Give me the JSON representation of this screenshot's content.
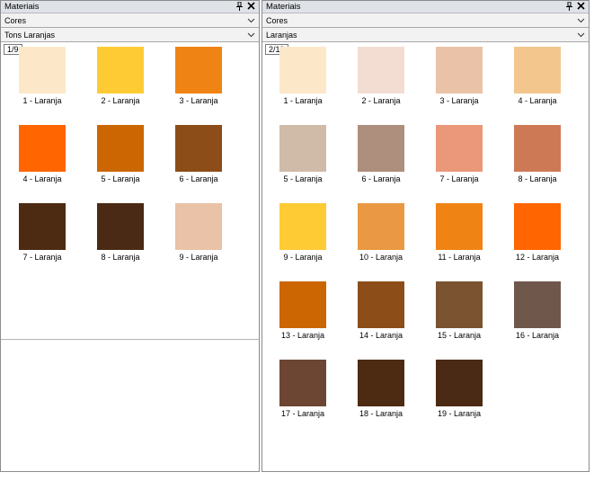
{
  "left_panel": {
    "title": "Materiais",
    "category": "Cores",
    "subcategory": "Tons Laranjas",
    "counter": "1/9",
    "swatches": [
      {
        "label": "1 - Laranja",
        "color": "#fce8c9"
      },
      {
        "label": "2 - Laranja",
        "color": "#fecb35"
      },
      {
        "label": "3 - Laranja",
        "color": "#ef8415"
      },
      {
        "label": "4 - Laranja",
        "color": "#ff6501"
      },
      {
        "label": "5 - Laranja",
        "color": "#cc6603"
      },
      {
        "label": "6 - Laranja",
        "color": "#8c4d18"
      },
      {
        "label": "7 - Laranja",
        "color": "#4d2a12"
      },
      {
        "label": "8 - Laranja",
        "color": "#4a2a14"
      },
      {
        "label": "9 - Laranja",
        "color": "#eac2a7"
      }
    ]
  },
  "right_panel": {
    "title": "Materiais",
    "category": "Cores",
    "subcategory": "Laranjas",
    "counter": "2/19",
    "swatches": [
      {
        "label": "1 - Laranja",
        "color": "#fce8c9"
      },
      {
        "label": "2 - Laranja",
        "color": "#f3ddd2"
      },
      {
        "label": "3 - Laranja",
        "color": "#eac2a7"
      },
      {
        "label": "4 - Laranja",
        "color": "#f3c68e"
      },
      {
        "label": "5 - Laranja",
        "color": "#d0bba9"
      },
      {
        "label": "6 - Laranja",
        "color": "#ae8e7d"
      },
      {
        "label": "7 - Laranja",
        "color": "#ea9879"
      },
      {
        "label": "8 - Laranja",
        "color": "#ce7955"
      },
      {
        "label": "9 - Laranja",
        "color": "#fecb35"
      },
      {
        "label": "10 - Laranja",
        "color": "#ea9843"
      },
      {
        "label": "11 - Laranja",
        "color": "#ef8415"
      },
      {
        "label": "12 - Laranja",
        "color": "#ff6501"
      },
      {
        "label": "13 - Laranja",
        "color": "#cc6603"
      },
      {
        "label": "14 - Laranja",
        "color": "#8c4d18"
      },
      {
        "label": "15 - Laranja",
        "color": "#7b5330"
      },
      {
        "label": "16 - Laranja",
        "color": "#6f574c"
      },
      {
        "label": "17 - Laranja",
        "color": "#6c4632"
      },
      {
        "label": "18 - Laranja",
        "color": "#4d2a12"
      },
      {
        "label": "19 - Laranja",
        "color": "#4a2a14"
      }
    ]
  }
}
